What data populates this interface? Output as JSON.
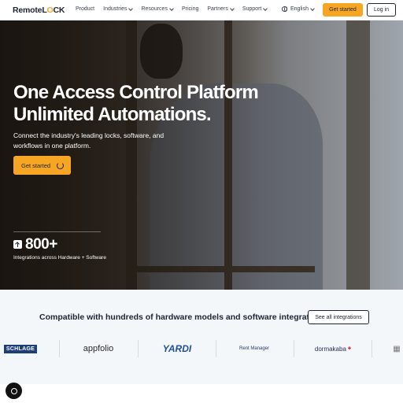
{
  "nav": {
    "logo_prefix": "Remote",
    "logo_suffix": "L",
    "logo_o": "O",
    "logo_end": "CK",
    "items": [
      {
        "label": "Product",
        "dropdown": false
      },
      {
        "label": "Industries",
        "dropdown": true
      },
      {
        "label": "Resources",
        "dropdown": true
      },
      {
        "label": "Pricing",
        "dropdown": false
      },
      {
        "label": "Partners",
        "dropdown": true
      },
      {
        "label": "Support",
        "dropdown": true
      }
    ],
    "language": "English",
    "get_started": "Get started",
    "login": "Log in"
  },
  "hero": {
    "title_line1": "One Access Control Platform",
    "title_line2": "Unlimited Automations.",
    "subtitle": "Connect the industry's leading locks, software, and workflows in one platform.",
    "cta": "Get started",
    "stat_value": "800+",
    "stat_label": "Integrations across Hardware + Software"
  },
  "compat": {
    "title": "Compatible with hundreds of hardware models and software integrations.",
    "button": "See all integrations",
    "logos": {
      "schlage": "SCHLAGE",
      "appfolio": "appfolio",
      "yardi": "YARDI",
      "rentmanager": "Rent Manager",
      "dormakaba": "dormakaba",
      "dormakaba_mark": "✚"
    }
  },
  "colors": {
    "accent": "#f6a623",
    "dark": "#1d2433",
    "section_bg": "#f4f7f9"
  }
}
